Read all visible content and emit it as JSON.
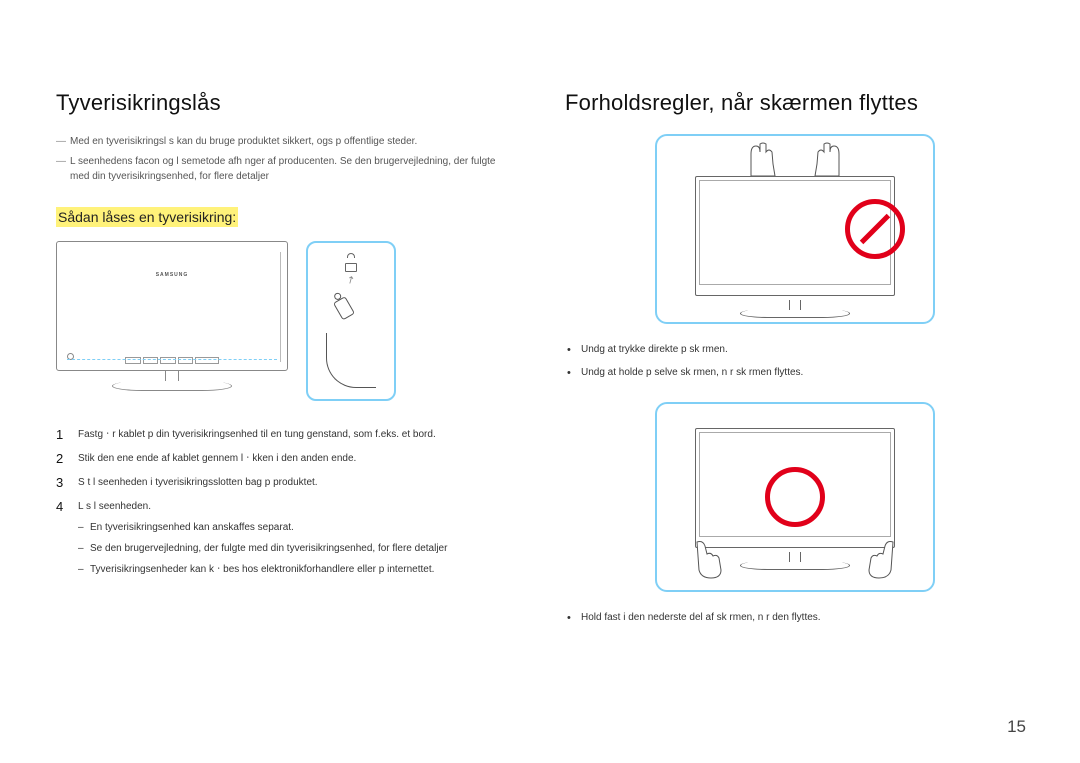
{
  "page_number": "15",
  "left": {
    "heading": "Tyverisikringslås",
    "note1": "Med en tyverisikringsl s kan du bruge produktet sikkert, ogs  p  offentlige steder.",
    "note2": "L seenhedens facon og l semetode afh nger af producenten. Se den brugervejledning, der fulgte med din tyverisikringsenhed, for flere detaljer",
    "subheading": "Sådan låses en tyverisikring:",
    "monitor_brand": "SAMSUNG",
    "steps": {
      "s1": "Fastgㆍr kablet p  din tyverisikringsenhed til en tung genstand, som f.eks. et bord.",
      "s2": "Stik den ene ende af kablet gennem lㆍkken i den anden ende.",
      "s3": "S t l seenheden i tyverisikringsslotten bag p  produktet.",
      "s4": "L s l seenheden.",
      "sub1": "En tyverisikringsenhed kan anskaffes separat.",
      "sub2": "Se den brugervejledning, der fulgte med din tyverisikringsenhed, for flere detaljer",
      "sub3": "Tyverisikringsenheder kan kㆍbes hos elektronikforhandlere eller p  internettet."
    }
  },
  "right": {
    "heading": "Forholdsregler, når skærmen flyttes",
    "bullets1": {
      "b1": "Undg  at trykke direkte p  sk rmen.",
      "b2": "Undg  at holde p  selve sk rmen, n r sk rmen flyttes."
    },
    "bullets2": {
      "b1": "Hold fast i den nederste del af sk rmen, n r den flyttes."
    }
  }
}
